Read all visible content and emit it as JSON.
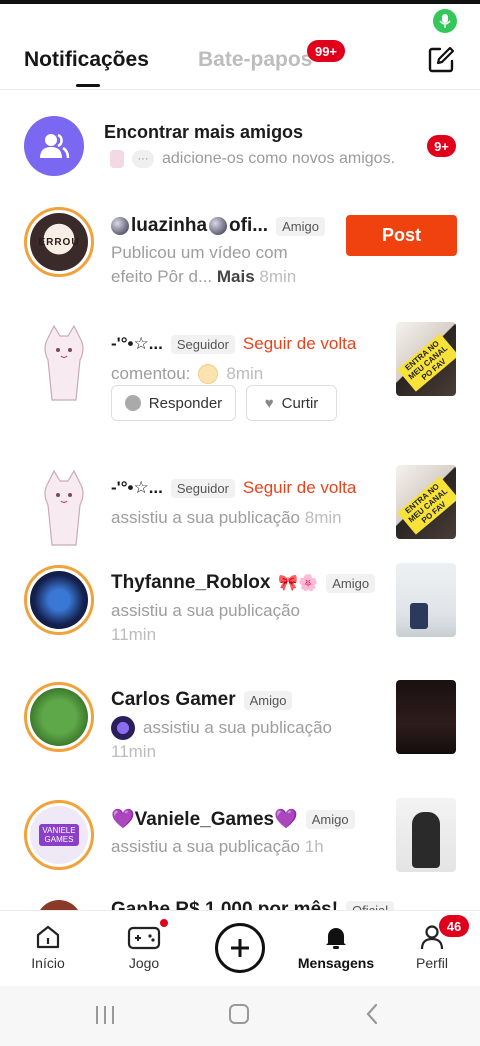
{
  "status_bar": {
    "mic_icon": "mic-icon",
    "mic_color": "#34c85a"
  },
  "header": {
    "tab_notifications": "Notificações",
    "tab_chats": "Bate-papos",
    "chats_badge": "99+",
    "compose_icon": "compose-icon"
  },
  "find_friends": {
    "title": "Encontrar mais amigos",
    "subtitle": "adicione-os como novos amigos.",
    "dots": "···",
    "badge": "9+"
  },
  "notifications": [
    {
      "name": "luazinha",
      "name_suffix": "ofi...",
      "tag": "Amigo",
      "line1": "Publicou um vídeo com",
      "line2": "efeito Pôr d...",
      "more": "Mais",
      "time": "8min",
      "button": "Post"
    },
    {
      "name": "-'°•☆...",
      "tag": "Seguidor",
      "follow_back": "Seguir de volta",
      "line1": "comentou:",
      "time": "8min",
      "reply_label": "Responder",
      "like_label": "Curtir"
    },
    {
      "name": "-'°•☆...",
      "tag": "Seguidor",
      "follow_back": "Seguir de volta",
      "line1": "assistiu a sua publicação",
      "time": "8min"
    },
    {
      "name": "Thyfanne_Roblox",
      "emoji": "🎀🌸",
      "tag": "Amigo",
      "line1": "assistiu a sua publicação",
      "time": "11min"
    },
    {
      "name": "Carlos Gamer",
      "tag": "Amigo",
      "line1": "assistiu a sua publicação",
      "time": "11min"
    },
    {
      "name": "💜Vaniele_Games💜",
      "tag": "Amigo",
      "line1": "assistiu a sua publicação",
      "time": "1h"
    },
    {
      "name": "Ganhe R$ 1.000 por mês!",
      "tag": "Oficial"
    }
  ],
  "thumb_texts": {
    "thumb1": "ENTRA NO MEU CANAL PO FAV",
    "vaniele_avatar": "VANIELE GAMES",
    "errou": "ERROU"
  },
  "bottom_nav": {
    "home": "Início",
    "game": "Jogo",
    "messages": "Mensagens",
    "profile": "Perfil",
    "profile_badge": "46"
  },
  "colors": {
    "accent": "#f0420f",
    "badge": "#e0001b",
    "ring": "#f2a23a",
    "purple": "#7a67f2"
  }
}
